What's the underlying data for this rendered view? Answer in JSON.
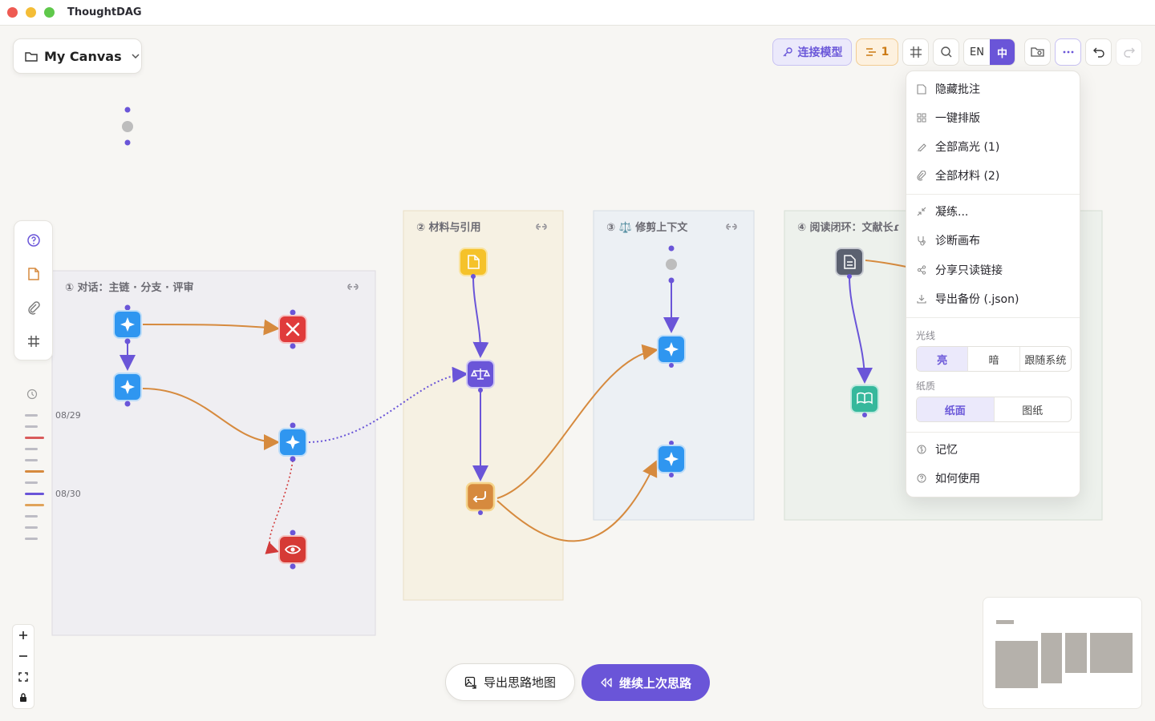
{
  "app": {
    "title": "ThoughtDAG"
  },
  "canvas_picker": {
    "name": "My Canvas",
    "folder_icon": "folder-icon",
    "chevron_icon": "chevron-down-icon"
  },
  "toolbar": {
    "connect_model": "连接模型",
    "pending_count": "1",
    "lang_en": "EN",
    "lang_zh": "中",
    "accent": "#6a55d8"
  },
  "panels": [
    {
      "title": "① 对话：主链 · 分支 · 评审",
      "color": "#efeef2"
    },
    {
      "title": "② 材料与引用",
      "color": "#f6f1e3"
    },
    {
      "title": "③ ⚖️ 修剪上下文",
      "color": "#ecf0f4"
    },
    {
      "title": "④ 阅读闭环：文献长ɾ",
      "color": "#edf1ec"
    }
  ],
  "timeline": {
    "dates": [
      "08/29",
      "08/30"
    ]
  },
  "menu": {
    "items_top": [
      {
        "label": "隐藏批注",
        "icon": "note-icon"
      },
      {
        "label": "一键排版",
        "icon": "layout-grid-icon"
      },
      {
        "label": "全部高光 (1)",
        "icon": "highlighter-icon"
      },
      {
        "label": "全部材料 (2)",
        "icon": "paperclip-icon"
      }
    ],
    "items_mid": [
      {
        "label": "凝练...",
        "icon": "compress-icon"
      },
      {
        "label": "诊断画布",
        "icon": "stethoscope-icon"
      },
      {
        "label": "分享只读链接",
        "icon": "share-icon"
      },
      {
        "label": "导出备份 (.json)",
        "icon": "download-icon"
      }
    ],
    "theme_label": "光线",
    "theme_options": [
      "亮",
      "暗",
      "跟随系统"
    ],
    "theme_selected": "亮",
    "paper_label": "纸质",
    "paper_options": [
      "纸面",
      "图纸"
    ],
    "paper_selected": "纸面",
    "items_bottom": [
      {
        "label": "记忆",
        "icon": "memory-icon"
      },
      {
        "label": "如何使用",
        "icon": "help-icon"
      }
    ]
  },
  "bottom": {
    "export_map": "导出思路地图",
    "continue_last": "继续上次思路"
  },
  "colors": {
    "purple": "#6a55d8",
    "orange": "#d68a3e",
    "blue": "#2f96f0",
    "red": "#e03b3b",
    "yellow": "#f5c22a",
    "teal": "#36b89c",
    "slate": "#5b6170"
  }
}
